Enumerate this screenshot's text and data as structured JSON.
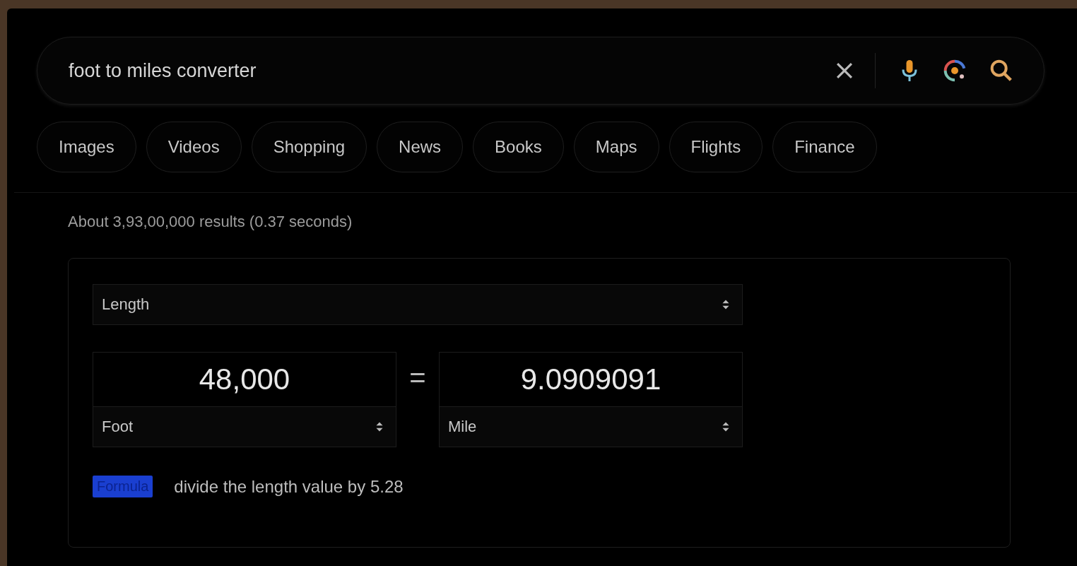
{
  "search": {
    "value": "foot to miles converter"
  },
  "tabs": [
    {
      "label": "Images"
    },
    {
      "label": "Videos"
    },
    {
      "label": "Shopping"
    },
    {
      "label": "News"
    },
    {
      "label": "Books"
    },
    {
      "label": "Maps"
    },
    {
      "label": "Flights"
    },
    {
      "label": "Finance"
    }
  ],
  "results_count": "About 3,93,00,000 results (0.37 seconds)",
  "converter": {
    "quantity": "Length",
    "from": {
      "value": "48,000",
      "unit": "Foot"
    },
    "equals": "=",
    "to": {
      "value": "9.0909091",
      "unit": "Mile"
    },
    "formula_label": "Formula",
    "formula": "divide the length value by 5.28"
  }
}
